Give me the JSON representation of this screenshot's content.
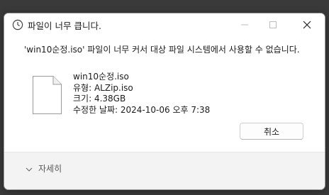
{
  "window": {
    "title": "파일이 너무 큽니다."
  },
  "titlebar": {
    "minimize_icon": "minimize-icon",
    "maximize_icon": "maximize-icon",
    "close_icon": "close-icon"
  },
  "message": {
    "text": "'win10순정.iso' 파일이 너무 커서 대상 파일 시스템에서 사용할 수 없습니다."
  },
  "file": {
    "name": "win10순정.iso",
    "type_label": "유형:",
    "type_value": "ALZip.iso",
    "size_label": "크기:",
    "size_value": "4.38GB",
    "modified_label": "수정한 날짜:",
    "modified_value": "2024-10-06 오후 7:38"
  },
  "buttons": {
    "cancel_label": "취소"
  },
  "footer": {
    "details_label": "자세히"
  },
  "colors": {
    "background": "#3a3a3a",
    "window": "#ffffff",
    "footer": "#f3f3f3"
  }
}
